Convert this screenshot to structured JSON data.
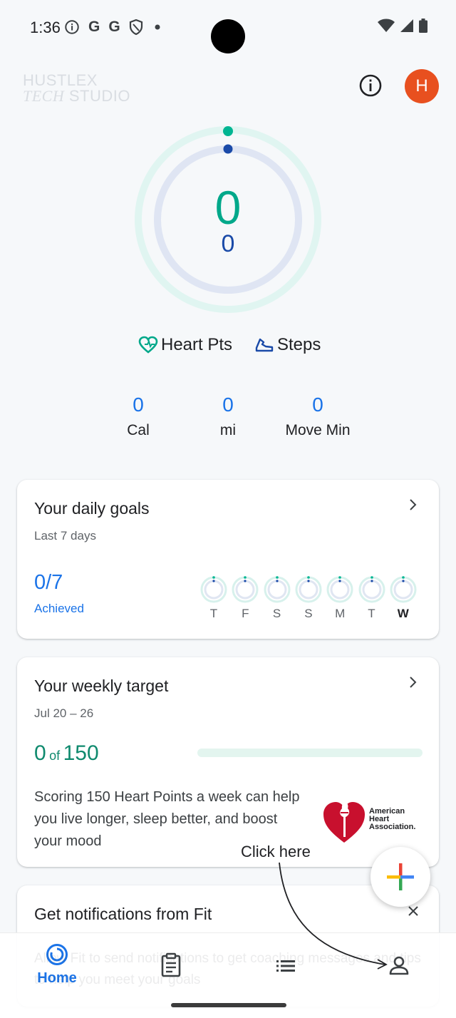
{
  "status_bar": {
    "time": "1:36",
    "icons": [
      "info-circle-icon",
      "google-g-icon",
      "google-g-icon",
      "shield-icon",
      "dot-icon"
    ],
    "right_icons": [
      "wifi-icon",
      "cellular-icon",
      "battery-icon"
    ]
  },
  "header": {
    "watermark_line1": "HUSTLEX",
    "watermark_line2a": "TECH",
    "watermark_line2b": "STUDIO",
    "avatar_letter": "H",
    "accent": "#e8501f"
  },
  "ring": {
    "heart_points": "0",
    "steps": "0",
    "heart_color": "#00a88a",
    "steps_color": "#1a4aa8",
    "heart_progress": 0,
    "steps_progress": 0
  },
  "legend": {
    "heart_label": "Heart Pts",
    "steps_label": "Steps"
  },
  "metrics": [
    {
      "value": "0",
      "label": "Cal"
    },
    {
      "value": "0",
      "label": "mi"
    },
    {
      "value": "0",
      "label": "Move Min"
    }
  ],
  "daily_goals": {
    "title": "Your daily goals",
    "subtitle": "Last 7 days",
    "achieved_value": "0/7",
    "achieved_label": "Achieved",
    "days": [
      "T",
      "F",
      "S",
      "S",
      "M",
      "T",
      "W"
    ],
    "current_day_index": 6
  },
  "weekly_target": {
    "title": "Your weekly target",
    "date_range": "Jul 20 – 26",
    "value": "0",
    "of_word": "of",
    "target": "150",
    "progress": 0,
    "description": "Scoring 150 Heart Points a week can help you live longer, sleep better, and boost your mood",
    "aha_line1": "American",
    "aha_line2": "Heart",
    "aha_line3": "Association."
  },
  "notifications_card": {
    "title": "Get notifications from Fit",
    "body": "Allow Fit to send notifications to get coaching messages and tips to help you meet your goals"
  },
  "bottom_nav": {
    "home_label": "Home",
    "items": [
      "home-icon",
      "journal-icon",
      "browse-icon",
      "profile-icon"
    ]
  },
  "annotation": {
    "text": "Click here"
  }
}
